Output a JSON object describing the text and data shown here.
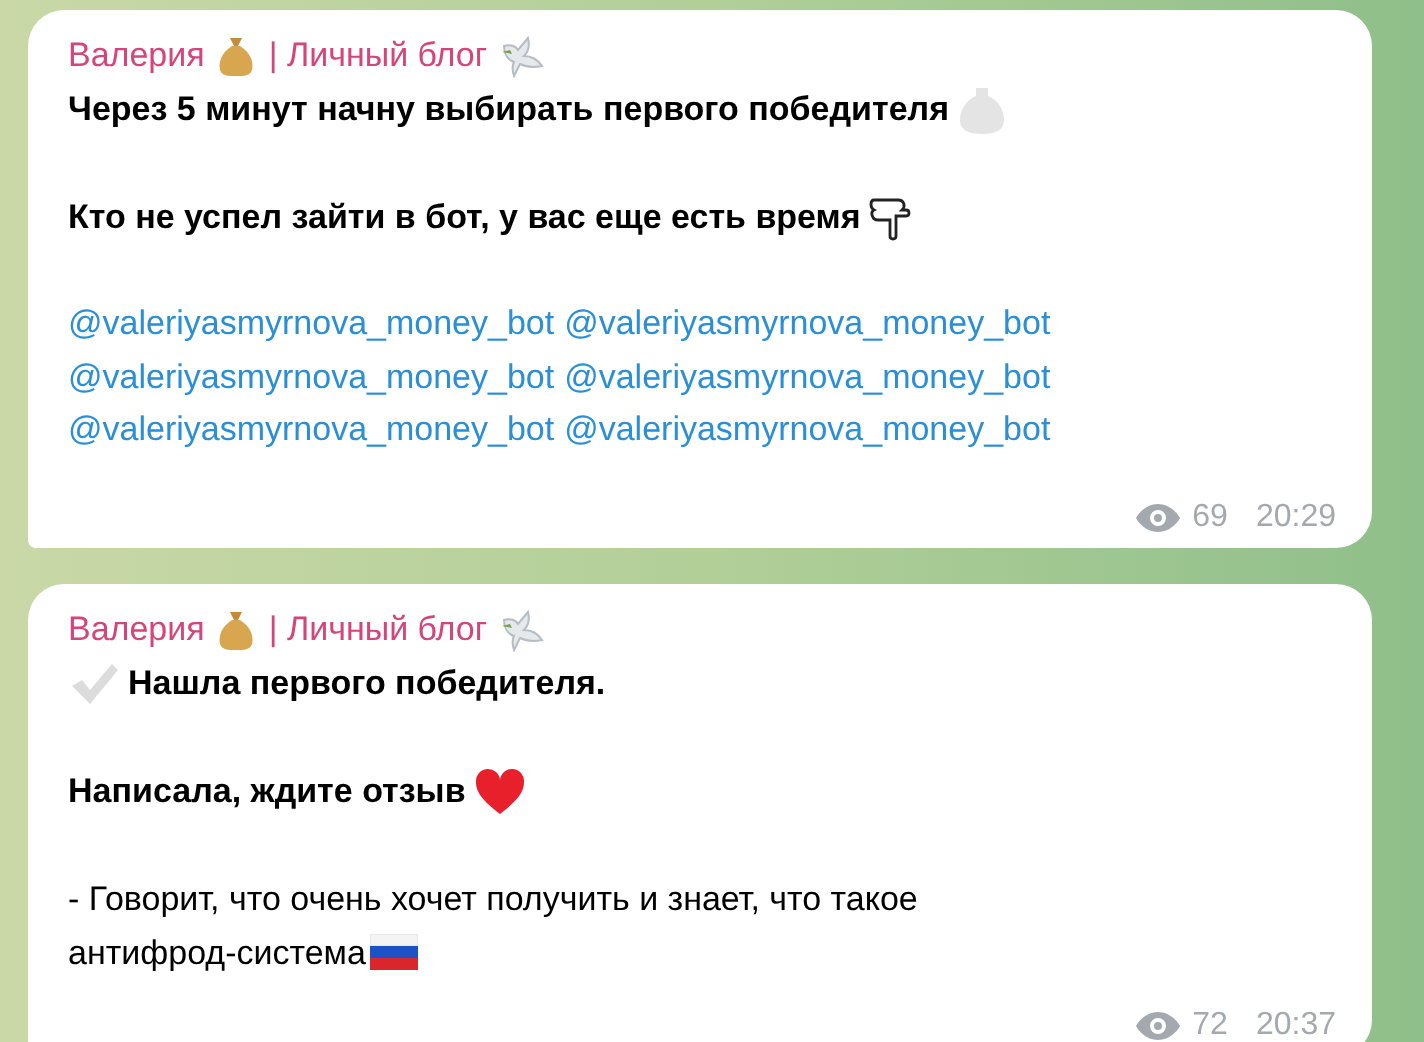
{
  "messages": [
    {
      "channel": "Валерия",
      "channel_suffix": "| Личный блог",
      "paragraphs": [
        {
          "kind": "bold",
          "text": "Через 5 минут начну выбирать первого победителя"
        },
        {
          "kind": "bold",
          "text": "Кто не успел зайти в бот, у вас еще есть время"
        },
        {
          "kind": "links",
          "links": [
            "@valeriyasmyrnova_money_bot",
            "@valeriyasmyrnova_money_bot",
            "@valeriyasmyrnova_money_bot",
            "@valeriyasmyrnova_money_bot",
            "@valeriyasmyrnova_money_bot",
            "@valeriyasmyrnova_money_bot"
          ]
        }
      ],
      "views": "69",
      "time": "20:29"
    },
    {
      "channel": "Валерия",
      "channel_suffix": "| Личный блог",
      "paragraphs": [
        {
          "kind": "bold",
          "text": "Нашла первого победителя."
        },
        {
          "kind": "bold",
          "text": "Написала, ждите отзыв"
        },
        {
          "kind": "plain",
          "text": "- Говорит, что очень хочет получить и знает, что такое антифрод-система"
        }
      ],
      "views": "72",
      "time": "20:37"
    }
  ]
}
